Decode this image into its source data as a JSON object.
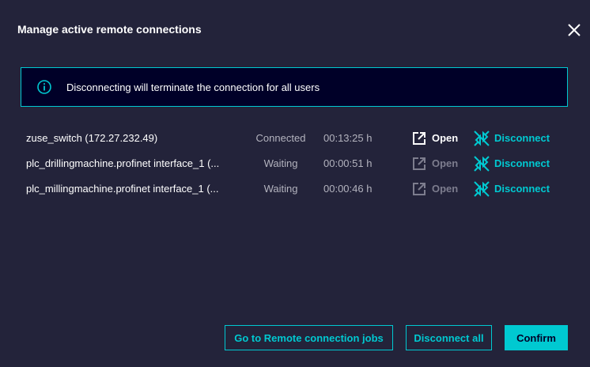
{
  "dialog": {
    "title": "Manage active remote connections"
  },
  "info": {
    "message": "Disconnecting will terminate the connection for all users",
    "icon": "info-icon"
  },
  "connections": [
    {
      "name": "zuse_switch (172.27.232.49)",
      "status": "Connected",
      "duration": "00:13:25 h",
      "open_label": "Open",
      "disconnect_label": "Disconnect",
      "open_enabled": true
    },
    {
      "name": "plc_drillingmachine.profinet interface_1 (...",
      "status": "Waiting",
      "duration": "00:00:51 h",
      "open_label": "Open",
      "disconnect_label": "Disconnect",
      "open_enabled": false
    },
    {
      "name": "plc_millingmachine.profinet interface_1 (...",
      "status": "Waiting",
      "duration": "00:00:46 h",
      "open_label": "Open",
      "disconnect_label": "Disconnect",
      "open_enabled": false
    }
  ],
  "footer": {
    "jobs_label": "Go to Remote connection jobs",
    "disconnect_all_label": "Disconnect all",
    "confirm_label": "Confirm"
  },
  "colors": {
    "background": "#23233a",
    "accent": "#00c9d1",
    "info_background": "#000028",
    "muted_text": "#b3b3be",
    "disabled_text": "#7d7d8e"
  }
}
